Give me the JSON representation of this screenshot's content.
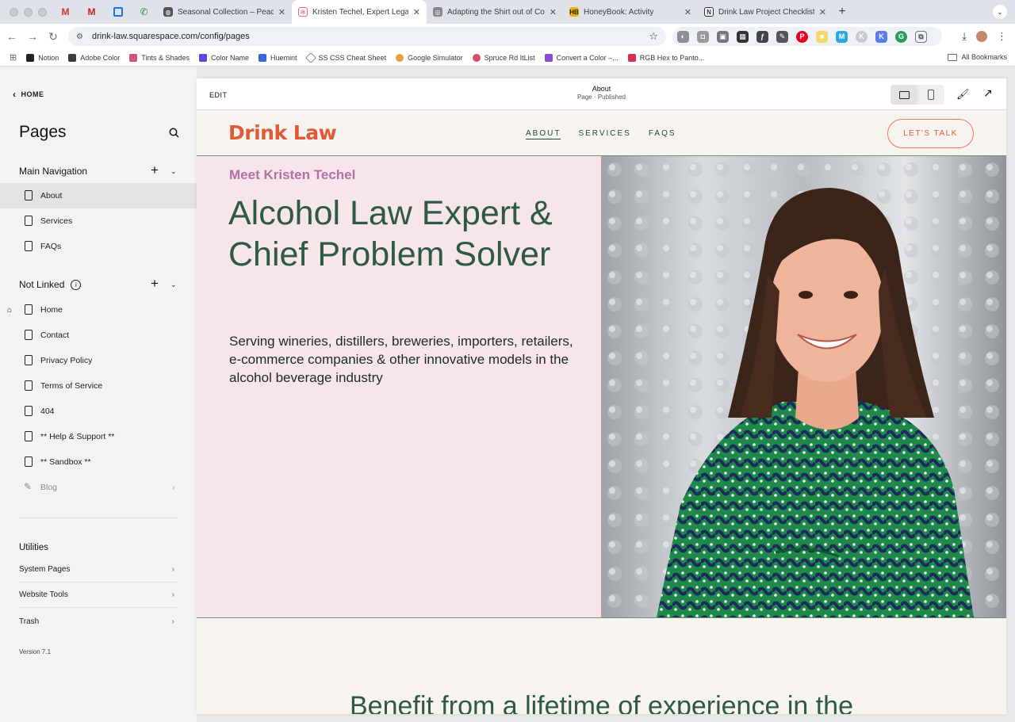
{
  "browser": {
    "tabs": [
      {
        "title": "",
        "kind": "pinned-gmail"
      },
      {
        "title": "",
        "kind": "pinned-gmail2"
      },
      {
        "title": "",
        "kind": "pinned-cal"
      },
      {
        "title": "",
        "kind": "pinned-phone"
      },
      {
        "title": "Seasonal Collection – Peace",
        "kind": "normal"
      },
      {
        "title": "Kristen Techel, Expert Legal C",
        "kind": "active"
      },
      {
        "title": "Adapting the Shirt out of Cod",
        "kind": "normal"
      },
      {
        "title": "HoneyBook: Activity",
        "kind": "normal"
      },
      {
        "title": "Drink Law Project Checklist",
        "kind": "normal"
      }
    ],
    "url": "drink-law.squarespace.com/config/pages",
    "bookmarks": [
      {
        "label": "Notion",
        "color": "#222222"
      },
      {
        "label": "Adobe Color",
        "color": "#3d3d3d"
      },
      {
        "label": "Tints & Shades",
        "color": "#d2557a"
      },
      {
        "label": "Color Name",
        "color": "#5b4bd4"
      },
      {
        "label": "Huemint",
        "color": "#3b66d8"
      },
      {
        "label": "SS CSS Cheat Sheet",
        "color": "#888888"
      },
      {
        "label": "Google Simulator",
        "color": "#e8a13a"
      },
      {
        "label": "Spruce Rd ItList",
        "color": "#d94b6a"
      },
      {
        "label": "Convert a Color –...",
        "color": "#8a4bd4"
      },
      {
        "label": "RGB Hex to Panto...",
        "color": "#d4324b"
      }
    ],
    "all_bookmarks": "All Bookmarks"
  },
  "sidebar": {
    "home_link": "HOME",
    "title": "Pages",
    "main_nav": {
      "heading": "Main Navigation",
      "items": [
        "About",
        "Services",
        "FAQs"
      ]
    },
    "not_linked": {
      "heading": "Not Linked",
      "items": [
        "Home",
        "Contact",
        "Privacy Policy",
        "Terms of Service",
        "404",
        "** Help & Support **",
        "** Sandbox **",
        "Blog"
      ]
    },
    "utilities": {
      "heading": "Utilities",
      "items": [
        "System Pages",
        "Website Tools",
        "Trash"
      ]
    },
    "version": "Version 7.1"
  },
  "editor": {
    "edit_label": "EDIT",
    "page_title": "About",
    "page_status": "Page · Published"
  },
  "site": {
    "logo": "Drink Law",
    "nav": [
      "ABOUT",
      "SERVICES",
      "FAQS"
    ],
    "cta": "LET'S TALK",
    "eyebrow": "Meet Kristen Techel",
    "headline": "Alcohol Law Expert & Chief Problem Solver",
    "body": "Serving wineries, distillers, breweries, importers, retailers, e-commerce companies & other innovative models in the alcohol beverage industry",
    "below_heading": "Benefit from a lifetime of experience in the",
    "colors": {
      "brand_orange": "#e05a3a",
      "green": "#2e5a43",
      "pink_bg": "#f6e6ea",
      "eyebrow_purple": "#b46fa6"
    }
  }
}
